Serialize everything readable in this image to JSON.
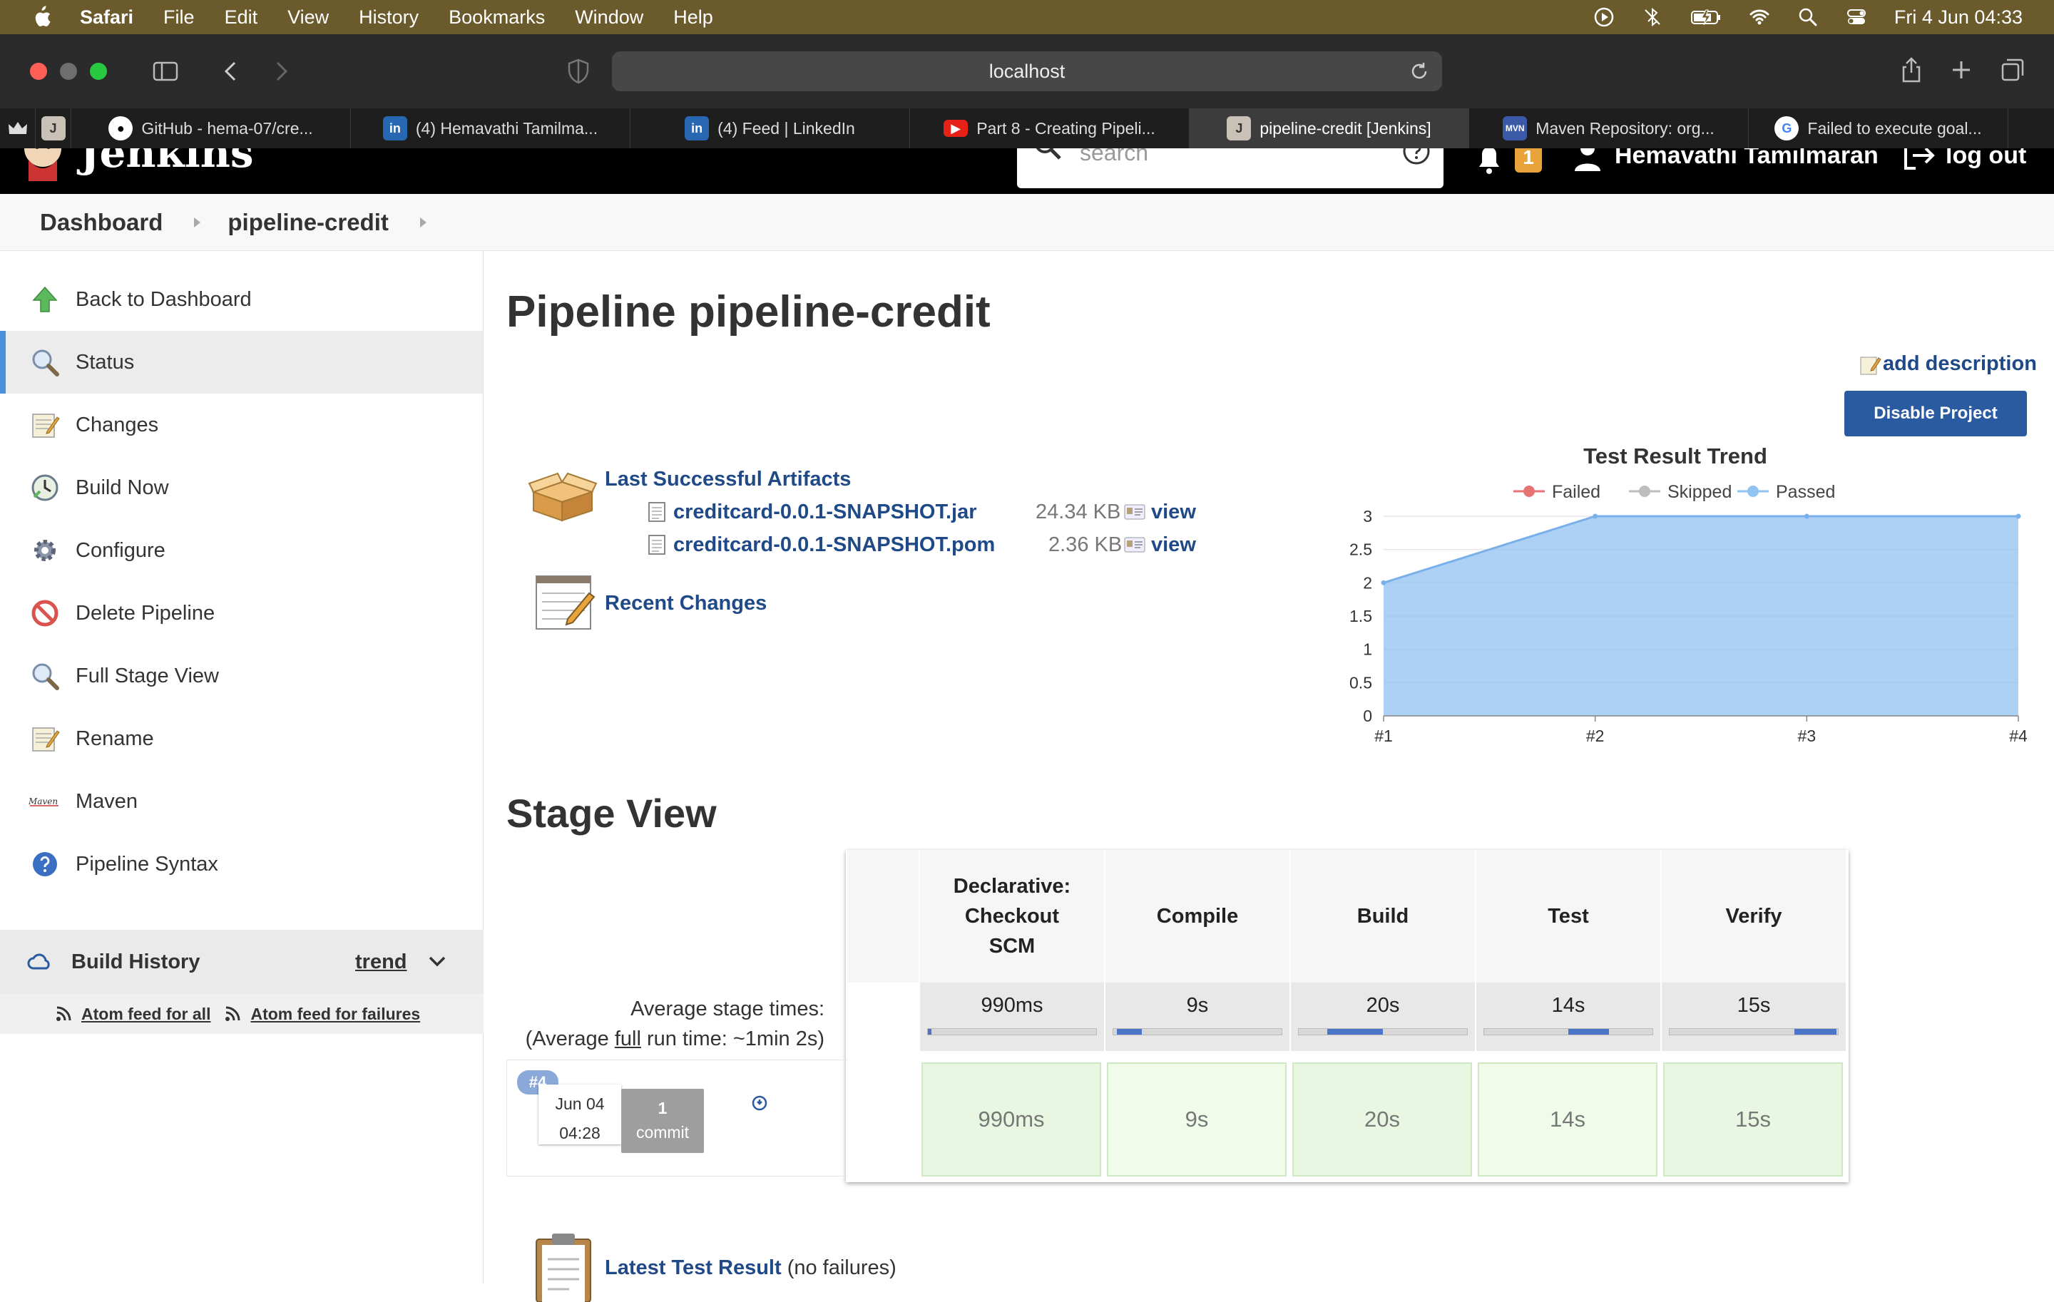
{
  "menubar": {
    "app": "Safari",
    "items": [
      "File",
      "Edit",
      "View",
      "History",
      "Bookmarks",
      "Window",
      "Help"
    ],
    "clock": "Fri 4 Jun  04:33"
  },
  "browser": {
    "url": "localhost",
    "tabs": [
      {
        "label": "GitHub - hema-07/cre...",
        "icon": "github-icon"
      },
      {
        "label": "(4) Hemavathi Tamilma...",
        "icon": "linkedin-icon"
      },
      {
        "label": "(4) Feed | LinkedIn",
        "icon": "linkedin-icon"
      },
      {
        "label": "Part 8 - Creating Pipeli...",
        "icon": "youtube-icon"
      },
      {
        "label": "pipeline-credit [Jenkins]",
        "icon": "jenkins-icon",
        "active": true
      },
      {
        "label": "Maven Repository: org...",
        "icon": "maven-icon"
      },
      {
        "label": "Failed to execute goal...",
        "icon": "google-icon"
      }
    ]
  },
  "jenkins": {
    "brand": "Jenkins",
    "search_placeholder": "search",
    "notification_count": "1",
    "user": "Hemavathi Tamilmaran",
    "logout": "log out"
  },
  "breadcrumb": [
    "Dashboard",
    "pipeline-credit"
  ],
  "sidebar": {
    "tasks": [
      {
        "label": "Back to Dashboard",
        "icon": "up-arrow-icon"
      },
      {
        "label": "Status",
        "icon": "magnifier-icon",
        "active": true
      },
      {
        "label": "Changes",
        "icon": "notepad-icon"
      },
      {
        "label": "Build Now",
        "icon": "clock-icon"
      },
      {
        "label": "Configure",
        "icon": "gear-icon"
      },
      {
        "label": "Delete Pipeline",
        "icon": "no-entry-icon"
      },
      {
        "label": "Full Stage View",
        "icon": "magnifier-icon"
      },
      {
        "label": "Rename",
        "icon": "notepad-icon"
      },
      {
        "label": "Maven",
        "icon": "maven-icon"
      },
      {
        "label": "Pipeline Syntax",
        "icon": "help-icon"
      }
    ],
    "build_history": {
      "label": "Build History",
      "trend": "trend"
    },
    "feeds": {
      "all": "Atom feed for all",
      "failures": "Atom feed for failures"
    }
  },
  "main": {
    "title": "Pipeline pipeline-credit",
    "add_description": "add description",
    "disable_button": "Disable Project",
    "artifacts": {
      "title": "Last Successful Artifacts",
      "files": [
        {
          "name": "creditcard-0.0.1-SNAPSHOT.jar",
          "size": "24.34 KB",
          "view": "view"
        },
        {
          "name": "creditcard-0.0.1-SNAPSHOT.pom",
          "size": "2.36 KB",
          "view": "view"
        }
      ]
    },
    "recent_changes": "Recent Changes",
    "latest_test_result": {
      "link": "Latest Test Result",
      "suffix": " (no failures)"
    }
  },
  "chart_data": {
    "type": "area",
    "title": "Test Result Trend",
    "legend": [
      "Failed",
      "Skipped",
      "Passed"
    ],
    "legend_position": "top",
    "x": [
      "#1",
      "#2",
      "#3",
      "#4"
    ],
    "yticks": [
      "0",
      "0.5",
      "1",
      "1.5",
      "2",
      "2.5",
      "3"
    ],
    "ylim": [
      0,
      3
    ],
    "series": [
      {
        "name": "Failed",
        "values": [
          0,
          0,
          0,
          0
        ],
        "color": "#e57373"
      },
      {
        "name": "Skipped",
        "values": [
          0,
          0,
          0,
          0
        ],
        "color": "#bdbdbd"
      },
      {
        "name": "Passed",
        "values": [
          2,
          3,
          3,
          3
        ],
        "color": "#90c2f2"
      }
    ]
  },
  "stage_view": {
    "title": "Stage View",
    "avg_label_1": "Average stage times:",
    "avg_label_2a": "(Average ",
    "avg_label_2b": "full",
    "avg_label_2c": " run time: ~1min 2s)",
    "stages": [
      {
        "name": "Declarative: Checkout SCM",
        "avg": "990ms",
        "run": "990ms",
        "bar_start": 0.0,
        "bar_frac": 0.02
      },
      {
        "name": "Compile",
        "avg": "9s",
        "run": "9s",
        "bar_start": 0.02,
        "bar_frac": 0.15
      },
      {
        "name": "Build",
        "avg": "20s",
        "run": "20s",
        "bar_start": 0.17,
        "bar_frac": 0.33
      },
      {
        "name": "Test",
        "avg": "14s",
        "run": "14s",
        "bar_start": 0.5,
        "bar_frac": 0.24
      },
      {
        "name": "Verify",
        "avg": "15s",
        "run": "15s",
        "bar_start": 0.74,
        "bar_frac": 0.25
      }
    ],
    "run": {
      "badge": "#4",
      "date": "Jun 04",
      "time": "04:28",
      "commits_count": "1",
      "commits_label": "commit"
    }
  }
}
